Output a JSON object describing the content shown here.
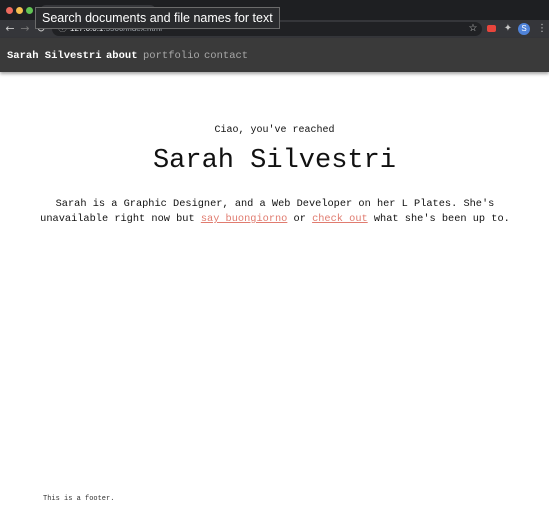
{
  "browser": {
    "tooltip": "Search documents and file names for text",
    "url_host": "127.0.0.1",
    "url_rest": ":5500/index.html",
    "profile_initial": "S"
  },
  "nav": {
    "brand": "Sarah Silvestri",
    "links": [
      "about",
      "portfolio",
      "contact"
    ],
    "active": "about"
  },
  "hero": {
    "greeting": "Ciao, you've reached",
    "name": "Sarah Silvestri",
    "intro_before": "Sarah is a Graphic Designer, and a Web Developer on her L Plates. She's unavailable right now but ",
    "link1": "say buongiorno",
    "intro_mid": " or ",
    "link2": "check out",
    "intro_after": " what she's been up to."
  },
  "footer": {
    "text": "This is a footer."
  },
  "colors": {
    "nav_bg": "#3a3a3a",
    "link_accent": "#e07b6f",
    "chrome_bg": "#202124"
  }
}
